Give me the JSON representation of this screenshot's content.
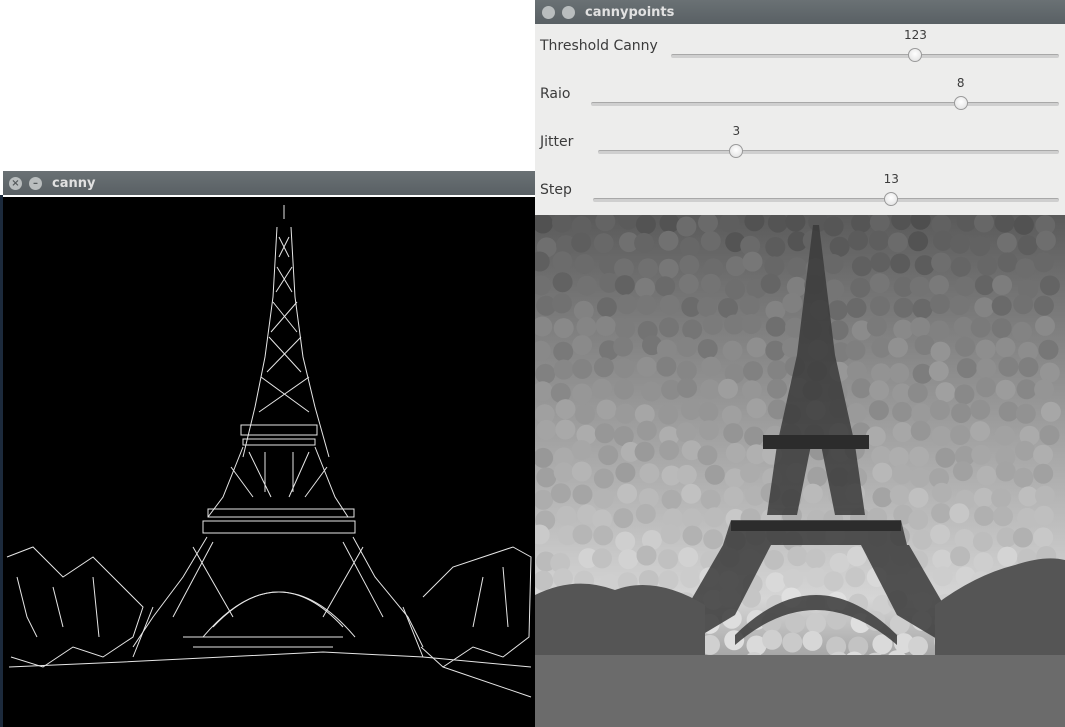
{
  "canny_window": {
    "title": "canny",
    "close_glyph": "×",
    "minimize_glyph": "–"
  },
  "points_window": {
    "title": "cannypoints",
    "trackbars": [
      {
        "label": "Threshold Canny",
        "value": "123",
        "fraction": 0.63
      },
      {
        "label": "Raio",
        "value": "8",
        "fraction": 0.79
      },
      {
        "label": "Jitter",
        "value": "3",
        "fraction": 0.3
      },
      {
        "label": "Step",
        "value": "13",
        "fraction": 0.64
      }
    ]
  }
}
